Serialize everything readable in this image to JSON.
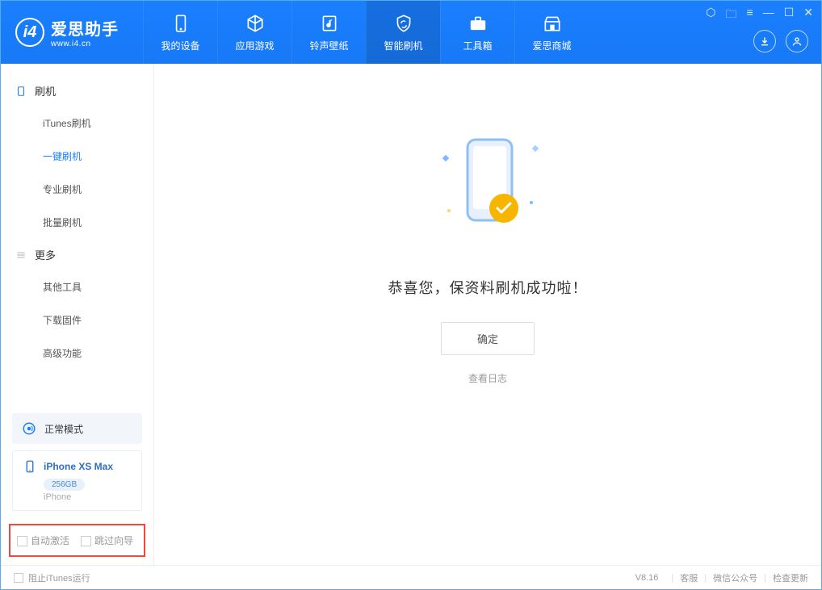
{
  "app": {
    "title": "爱思助手",
    "subtitle": "www.i4.cn"
  },
  "nav": {
    "items": [
      {
        "label": "我的设备"
      },
      {
        "label": "应用游戏"
      },
      {
        "label": "铃声壁纸"
      },
      {
        "label": "智能刷机"
      },
      {
        "label": "工具箱"
      },
      {
        "label": "爱思商城"
      }
    ]
  },
  "sidebar": {
    "group1": "刷机",
    "items1": [
      "iTunes刷机",
      "一键刷机",
      "专业刷机",
      "批量刷机"
    ],
    "group2": "更多",
    "items2": [
      "其他工具",
      "下载固件",
      "高级功能"
    ]
  },
  "mode": {
    "label": "正常模式"
  },
  "device": {
    "name": "iPhone XS Max",
    "capacity": "256GB",
    "type": "iPhone"
  },
  "options": {
    "auto_activate": "自动激活",
    "skip_guide": "跳过向导"
  },
  "main": {
    "success": "恭喜您，保资料刷机成功啦！",
    "ok": "确定",
    "view_log": "查看日志"
  },
  "footer": {
    "block_itunes": "阻止iTunes运行",
    "version": "V8.16",
    "links": [
      "客服",
      "微信公众号",
      "检查更新"
    ]
  }
}
